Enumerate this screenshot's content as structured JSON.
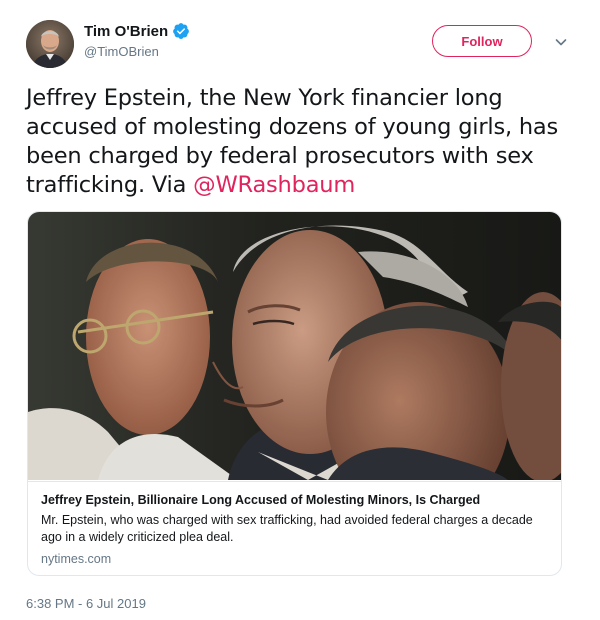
{
  "author": {
    "display_name": "Tim O'Brien",
    "handle": "@TimOBrien",
    "verified": true,
    "avatar_icon": "user-avatar"
  },
  "actions": {
    "follow_label": "Follow",
    "more_icon": "chevron-down-icon"
  },
  "tweet": {
    "text": "Jeffrey Epstein, the New York financier long accused of molesting dozens of young girls, has been charged by federal prosecutors with sex trafficking. Via ",
    "mention": "@WRashbaum",
    "timestamp": "6:38 PM - 6 Jul 2019"
  },
  "card": {
    "image_icon": "news-photo",
    "title": "Jeffrey Epstein, Billionaire Long Accused of Molesting Minors, Is Charged",
    "description": "Mr. Epstein, who was charged with sex trafficking, had avoided federal charges a decade ago in a widely criticized plea deal.",
    "domain": "nytimes.com"
  },
  "colors": {
    "accent": "#e0245e",
    "verified": "#1da1f2",
    "muted_text": "#657786",
    "border": "#e1e8ed"
  }
}
